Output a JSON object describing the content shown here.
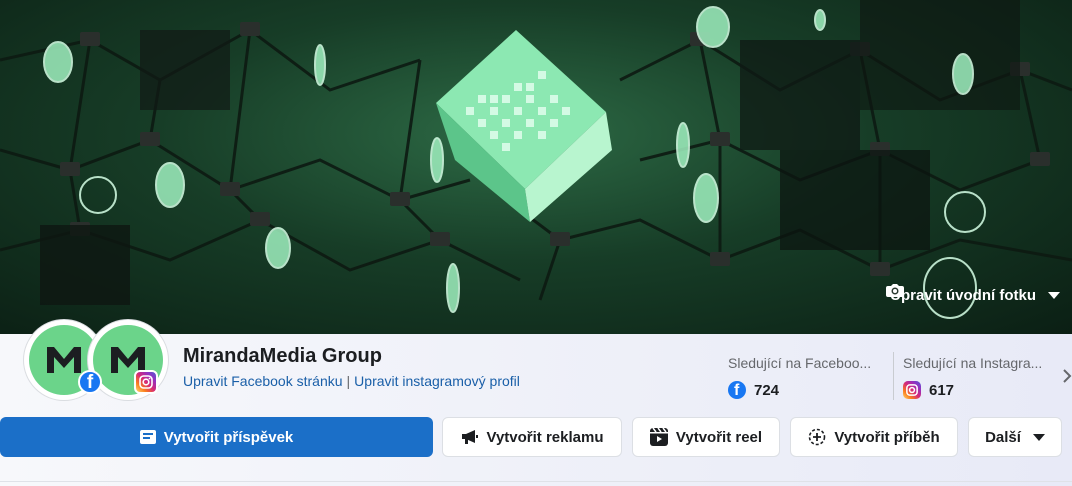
{
  "cover": {
    "edit_label": "Upravit úvodní fotku"
  },
  "profile": {
    "name": "MirandaMedia Group",
    "avatar_letter": "M",
    "link_facebook": "Upravit Facebook stránku",
    "link_separator": "|",
    "link_instagram": "Upravit instagramový profil"
  },
  "stats": [
    {
      "label": "Sledující na Faceboo...",
      "value": "724",
      "icon": "facebook-icon"
    },
    {
      "label": "Sledující na Instagra...",
      "value": "617",
      "icon": "instagram-icon"
    }
  ],
  "actions": {
    "create_post": "Vytvořit příspěvek",
    "create_ad": "Vytvořit reklamu",
    "create_reel": "Vytvořit reel",
    "create_story": "Vytvořit příběh",
    "more": "Další"
  },
  "colors": {
    "primary": "#1b6fc8",
    "link": "#1a5fa8",
    "brand_green": "#6bd48a",
    "facebook": "#1877f2"
  }
}
